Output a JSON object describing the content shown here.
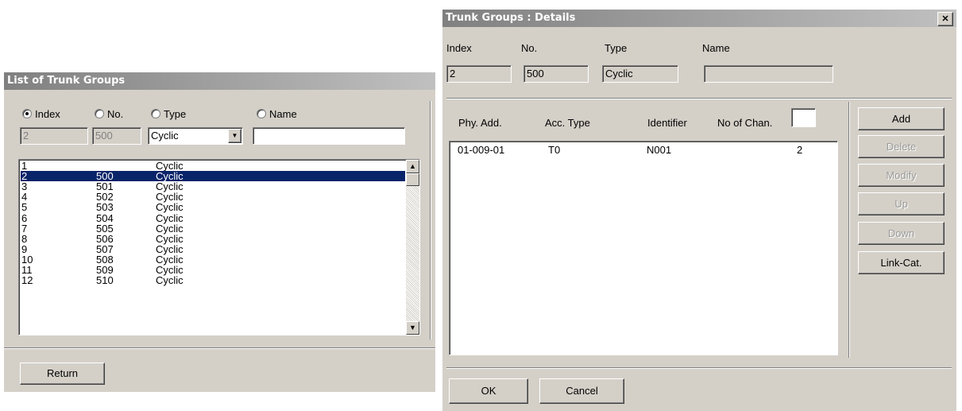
{
  "list_window": {
    "title": "List of Trunk Groups",
    "radios": [
      {
        "label": "Index",
        "selected": true
      },
      {
        "label": "No.",
        "selected": false
      },
      {
        "label": "Type",
        "selected": false
      },
      {
        "label": "Name",
        "selected": false
      }
    ],
    "filter": {
      "index": "2",
      "no": "500",
      "type": "Cyclic",
      "name": ""
    },
    "rows": [
      {
        "index": "1",
        "no": "",
        "type": "Cyclic"
      },
      {
        "index": "2",
        "no": "500",
        "type": "Cyclic"
      },
      {
        "index": "3",
        "no": "501",
        "type": "Cyclic"
      },
      {
        "index": "4",
        "no": "502",
        "type": "Cyclic"
      },
      {
        "index": "5",
        "no": "503",
        "type": "Cyclic"
      },
      {
        "index": "6",
        "no": "504",
        "type": "Cyclic"
      },
      {
        "index": "7",
        "no": "505",
        "type": "Cyclic"
      },
      {
        "index": "8",
        "no": "506",
        "type": "Cyclic"
      },
      {
        "index": "9",
        "no": "507",
        "type": "Cyclic"
      },
      {
        "index": "10",
        "no": "508",
        "type": "Cyclic"
      },
      {
        "index": "11",
        "no": "509",
        "type": "Cyclic"
      },
      {
        "index": "12",
        "no": "510",
        "type": "Cyclic"
      }
    ],
    "return_label": "Return"
  },
  "details_window": {
    "title": "Trunk Groups : Details",
    "close_glyph": "✕",
    "fields": {
      "index_label": "Index",
      "no_label": "No.",
      "type_label": "Type",
      "name_label": "Name",
      "index_value": "2",
      "no_value": "500",
      "type_value": "Cyclic",
      "name_value": ""
    },
    "columns": {
      "phy_add": "Phy. Add.",
      "acc_type": "Acc. Type",
      "identifier": "Identifier",
      "no_of_chan": "No of Chan."
    },
    "no_of_chan_value": "",
    "rows": [
      {
        "phy_add": "01-009-01",
        "acc_type": "T0",
        "identifier": "N001",
        "chan": "2"
      }
    ],
    "buttons": {
      "add": "Add",
      "delete": "Delete",
      "modify": "Modify",
      "up": "Up",
      "down": "Down",
      "link_cat": "Link-Cat."
    },
    "ok_label": "OK",
    "cancel_label": "Cancel"
  }
}
